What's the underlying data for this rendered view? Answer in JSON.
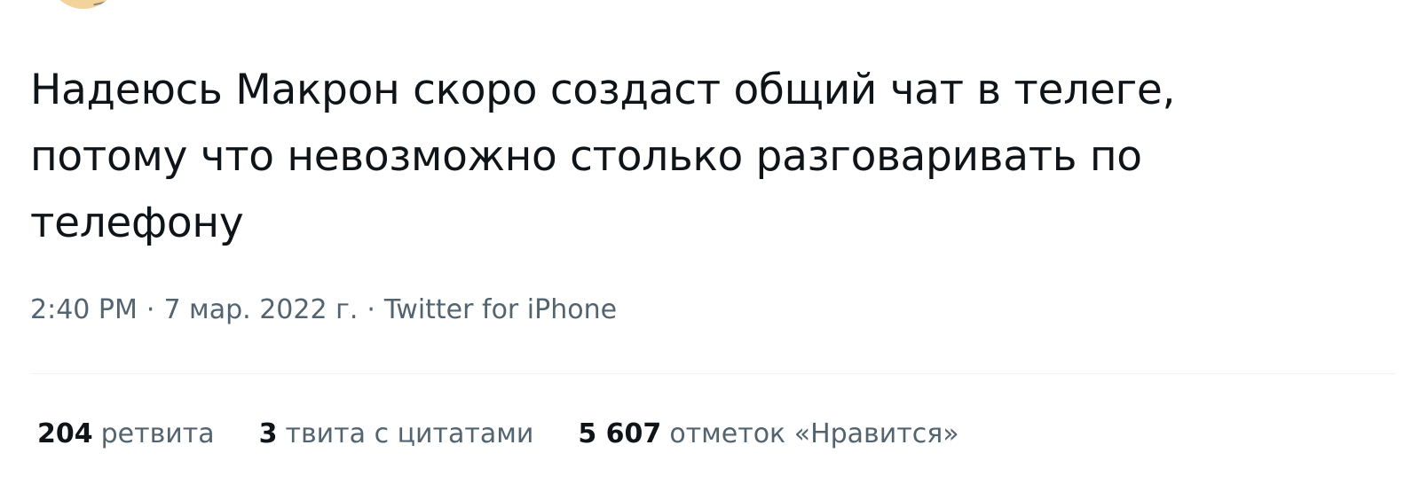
{
  "tweet": {
    "text_lines": [
      "Надеюсь Макрон скоро создаст общий чат в телеге,",
      "потому что невозможно столько разговаривать по",
      "телефону"
    ],
    "time": "2:40 PM",
    "separator": "·",
    "date": "7 мар. 2022 г.",
    "source": "Twitter for iPhone"
  },
  "stats": {
    "retweets": {
      "count": "204",
      "label": "ретвита"
    },
    "quotes": {
      "count": "3",
      "label": "твита с цитатами"
    },
    "likes": {
      "count": "5 607",
      "label": "отметок «Нравится»"
    }
  },
  "colors": {
    "text_primary": "#0f1419",
    "text_secondary": "#536471",
    "divider": "#eff3f4"
  }
}
